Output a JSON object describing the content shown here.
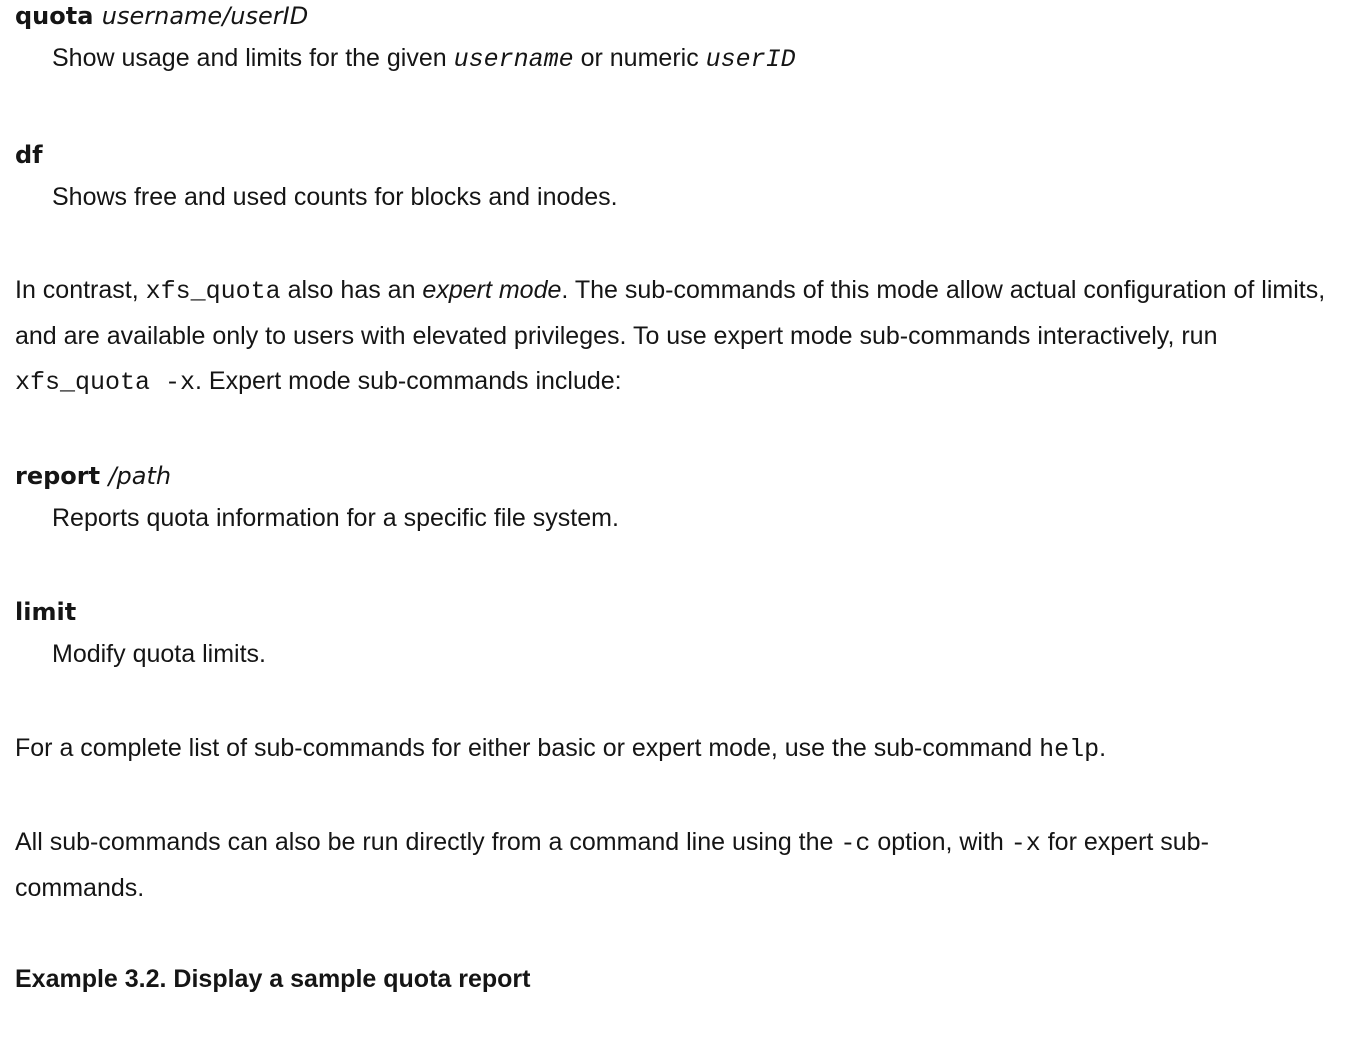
{
  "entries_basic": [
    {
      "term": "quota",
      "arg": "username/userID",
      "desc_prefix": "Show usage and limits for the given ",
      "desc_code1": "username",
      "desc_mid": " or numeric ",
      "desc_code2": "userID"
    },
    {
      "term": "df",
      "desc": "Shows free and used counts for blocks and inodes."
    }
  ],
  "contrast_para": {
    "t1": "In contrast, ",
    "c1": "xfs_quota",
    "t2": " also has an ",
    "em": "expert mode",
    "t3": ". The sub-commands of this mode allow actual configuration of limits, and are available only to users with elevated privileges. To use expert mode sub-commands interactively, run ",
    "c2": "xfs_quota -x",
    "t4": ". Expert mode sub-commands include:"
  },
  "entries_expert": [
    {
      "term": "report",
      "arg": "/path",
      "desc": "Reports quota information for a specific file system."
    },
    {
      "term": "limit",
      "desc": "Modify quota limits."
    }
  ],
  "help_para": {
    "t1": "For a complete list of sub-commands for either basic or expert mode, use the sub-command ",
    "c1": "help",
    "t2": "."
  },
  "cmdline_para": {
    "t1": "All sub-commands can also be run directly from a command line using the ",
    "c1": "-c",
    "t2": " option, with ",
    "c2": "-x",
    "t3": " for expert sub-commands."
  },
  "example_title": "Example 3.2. Display a sample quota report"
}
